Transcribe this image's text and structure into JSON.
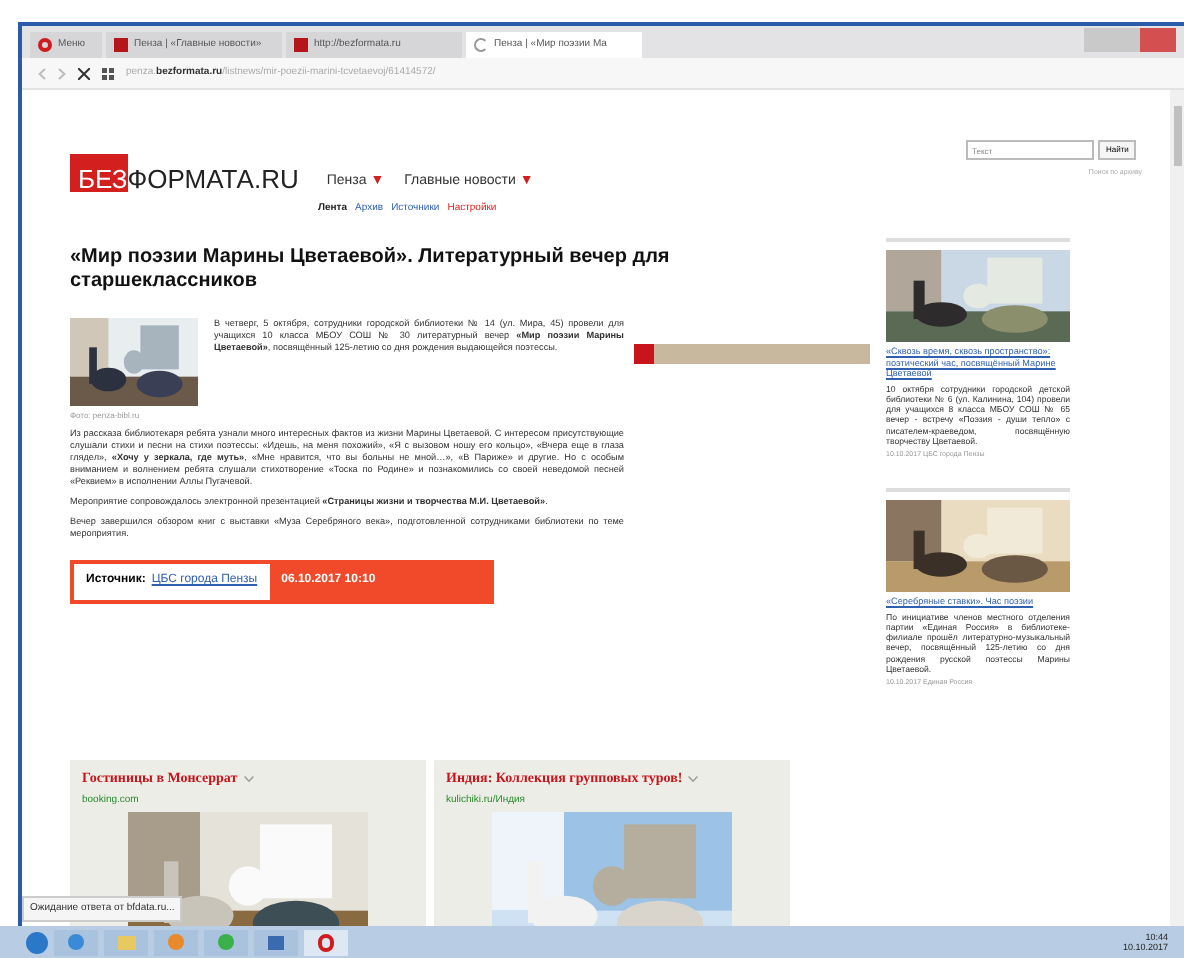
{
  "browser": {
    "tabs": [
      {
        "label": "Меню",
        "selected": false,
        "kind": "menu"
      },
      {
        "label": "Пенза | «Главные новости»",
        "selected": false,
        "kind": "page"
      },
      {
        "label": "http://bezformata.ru",
        "selected": false,
        "kind": "page"
      },
      {
        "label": "Пенза | «Мир поэзии Ма",
        "selected": true,
        "kind": "loading"
      }
    ],
    "address": {
      "prefix": "penza.",
      "domain": "bezformata.ru",
      "path": "/listnews/mir-poezii-marini-tcvetaevoj/61414572/"
    },
    "status": "Ожидание ответа от bfdata.ru..."
  },
  "site": {
    "logo_a": "БЕЗ",
    "logo_b": "ФОРМАТА.RU",
    "nav": [
      {
        "label": "Пенза",
        "caret": "▼"
      },
      {
        "label": "Главные новости",
        "caret": "▼"
      }
    ],
    "sublinks": [
      {
        "label": "Лента",
        "selected": true
      },
      {
        "label": "Архив",
        "selected": false
      },
      {
        "label": "Источники",
        "selected": false
      },
      {
        "label": "Настройки",
        "selected": false,
        "kind": "alert"
      }
    ],
    "search": {
      "placeholder": "Текст",
      "button": "Найти"
    },
    "search_hint": "Поиск по архиву"
  },
  "article": {
    "title": "«Мир поэзии Марины Цветаевой». Литературный вечер для старшеклассников",
    "caption": "Фото: penza-bibl.ru",
    "paragraphs": [
      "В четверг, 5 октября, сотрудники городской библиотеки № 14 (ул. Мира, 45) провели для учащихся 10 класса МБОУ СОШ № 30 литературный вечер **«Мир поэзии Марины Цветаевой»**, посвящённый 125-летию со дня рождения выдающейся поэтессы.",
      "Из рассказа библиотекаря ребята узнали много интересных фактов из жизни Марины Цветаевой. С интересом присутствующие слушали стихи и песни на стихи поэтессы: «Идешь, на меня похожий», «Я с вызовом ношу его кольцо», «Вчера еще в глаза глядел», **«Хочу у зеркала, где муть»**, «Мне нравится, что вы больны не мной…», «В Париже» и другие. Но с особым вниманием и волнением ребята слушали стихотворение «Тоска по Родине» и познакомились со своей неведомой песней «Реквием» в исполнении Аллы Пугачевой.",
      "Мероприятие сопровождалось электронной презентацией **«Страницы жизни и творчества М.И. Цветаевой»**.",
      "Вечер завершился обзором книг с выставки «Муза Серебряного века», подготовленной сотрудниками библиотеки по теме мероприятия."
    ],
    "source_label": "Источник:",
    "source": "ЦБС города Пензы",
    "date": "06.10.2017 10:10"
  },
  "ads": [
    {
      "title": "Гостиницы в Монсеррат",
      "site": "booking.com"
    },
    {
      "title": "Индия: Коллекция групповых туров!",
      "site": "kulichiki.ru/Индия"
    }
  ],
  "sidebar": [
    {
      "link": "«Сквозь время, сквозь пространство»: поэтический час, посвящённый Марине Цветаевой",
      "text": "10 октября сотрудники городской детской библиотеки № 6 (ул. Калинина, 104) провели для учащихся 8 класса МБОУ СОШ № 65 вечер - встречу «Поэзия - души тепло» с писателем-краеведом, посвящённую творчеству Цветаевой.",
      "meta": "10.10.2017 ЦБС города Пензы"
    },
    {
      "link": "«Серебряные ставки». Час поэзии",
      "text": "По инициативе членов местного отделения партии «Единая Россия» в библиотеке-филиале прошёл литературно-музыкальный вечер, посвящённый 125-летию со дня рождения русской поэтессы Марины Цветаевой.",
      "meta": "10.10.2017 Единая Россия"
    }
  ],
  "taskbar": {
    "time": "10:44",
    "date": "10.10.2017"
  }
}
